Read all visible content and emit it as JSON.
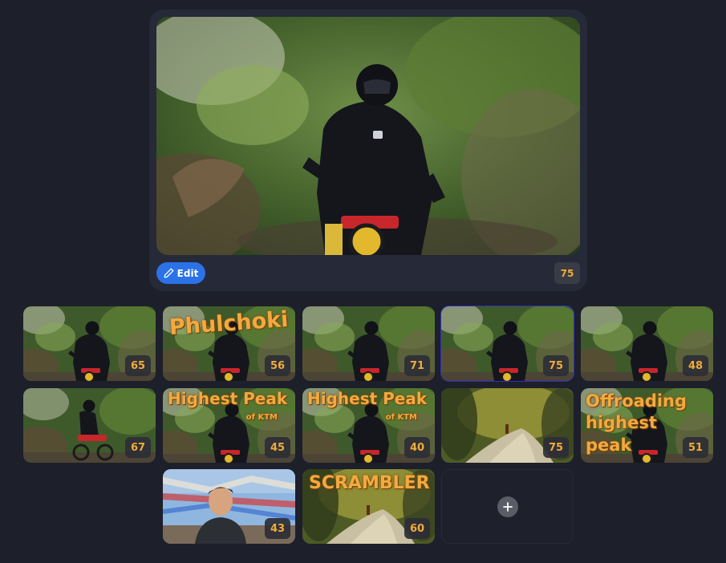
{
  "preview": {
    "score": "75",
    "edit_label": "Edit"
  },
  "colors": {
    "background": "#1d1f2b",
    "card": "#262937",
    "accent": "#2b72e8",
    "score_text": "#f0ac3a",
    "selected_outline": "#2f2fc4"
  },
  "thumbnails": [
    {
      "score": "65",
      "scene": "rider"
    },
    {
      "score": "56",
      "scene": "rider",
      "overlay": "Phulchoki"
    },
    {
      "score": "71",
      "scene": "rider"
    },
    {
      "score": "75",
      "scene": "rider",
      "selected": true
    },
    {
      "score": "48",
      "scene": "rider"
    },
    {
      "score": "67",
      "scene": "rider-side"
    },
    {
      "score": "45",
      "scene": "rider",
      "overlay": "Highest Peak",
      "overlay_sub": "of KTM"
    },
    {
      "score": "40",
      "scene": "rider",
      "overlay": "Highest Peak",
      "overlay_sub": "of KTM"
    },
    {
      "score": "75",
      "scene": "trail"
    },
    {
      "score": "51",
      "scene": "rider",
      "overlay": "Offroading highest peak"
    },
    {
      "score": "43",
      "scene": "selfie"
    },
    {
      "score": "60",
      "scene": "trail",
      "overlay": "SCRAMBLER"
    }
  ],
  "add_tile": {
    "icon": "plus-icon"
  }
}
